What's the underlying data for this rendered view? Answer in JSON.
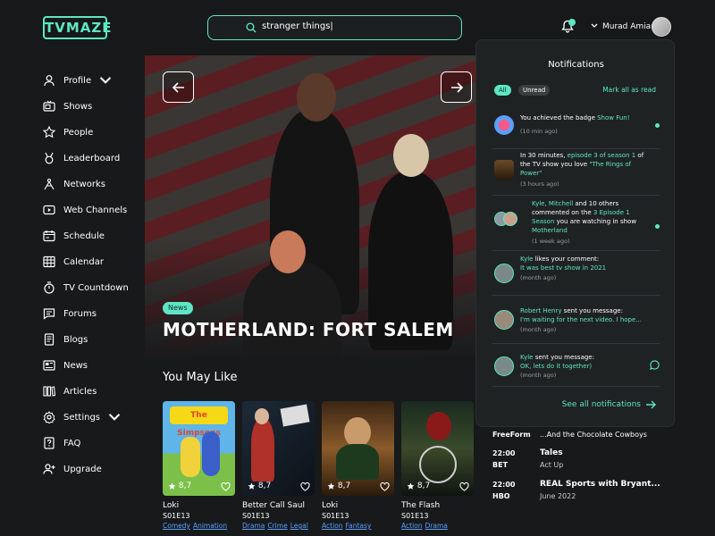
{
  "header": {
    "logo": "TVMAZE",
    "search_value": "stranger things|",
    "user_name": "Murad Amiar"
  },
  "sidebar": {
    "items": [
      {
        "label": "Profile",
        "icon": "user-icon"
      },
      {
        "label": "Shows",
        "icon": "tv-icon"
      },
      {
        "label": "People",
        "icon": "star-icon"
      },
      {
        "label": "Leaderboard",
        "icon": "medal-icon"
      },
      {
        "label": "Networks",
        "icon": "antenna-icon"
      },
      {
        "label": "Web Channels",
        "icon": "play-icon"
      },
      {
        "label": "Schedule",
        "icon": "schedule-icon"
      },
      {
        "label": "Calendar",
        "icon": "calendar-icon"
      },
      {
        "label": "TV Countdown",
        "icon": "timer-icon"
      },
      {
        "label": "Forums",
        "icon": "chat-icon"
      },
      {
        "label": "Blogs",
        "icon": "blog-icon"
      },
      {
        "label": "News",
        "icon": "news-icon"
      },
      {
        "label": "Articles",
        "icon": "articles-icon"
      },
      {
        "label": "Settings",
        "icon": "gear-icon"
      },
      {
        "label": "FAQ",
        "icon": "faq-icon"
      },
      {
        "label": "Upgrade",
        "icon": "user-plus-icon"
      }
    ]
  },
  "hero": {
    "tag": "News",
    "title": "MOTHERLAND: FORT SALEM"
  },
  "you_may_like": {
    "title": "You May Like",
    "cards": [
      {
        "title": "Loki",
        "episode": "S01E13",
        "rating": "8,7",
        "genres": [
          "Comedy",
          "Animation"
        ],
        "poster_text": "The Simpsons"
      },
      {
        "title": "Better Call Saul",
        "episode": "S01E13",
        "rating": "8,7",
        "genres": [
          "Drama",
          "Crime",
          "Legal"
        ],
        "poster_text": ""
      },
      {
        "title": "Loki",
        "episode": "S01E13",
        "rating": "8,7",
        "genres": [
          "Action",
          "Fantasy"
        ],
        "poster_text": ""
      },
      {
        "title": "The Flash",
        "episode": "S01E13",
        "rating": "8,7",
        "genres": [
          "Action",
          "Drama"
        ],
        "poster_text": ""
      }
    ]
  },
  "schedule": {
    "rows": [
      {
        "time": "FreeForm",
        "show": "...And the Chocolate Cowboys",
        "sub": ""
      },
      {
        "time": "22:00",
        "network": "BET",
        "show": "Tales",
        "sub": "Act Up"
      },
      {
        "time": "22:00",
        "network": "HBO",
        "show": "REAL Sports with Bryant...",
        "sub": "June 2022"
      }
    ]
  },
  "notifications": {
    "title": "Notifications",
    "filter_all": "All",
    "filter_unread": "Unread",
    "mark_all": "Mark all as read",
    "see_all": "See all notifications",
    "items": [
      {
        "pre": "You achieved the badge ",
        "hl": "Show Fun!",
        "post": "",
        "time": "(10 min ago)",
        "unread": true
      },
      {
        "pre": "In 30 minutes, ",
        "hl": "episode 3 of season 1",
        "post": " of the TV show you love ",
        "hl2": "\"The Rings of Power\"",
        "time": "(3 hours ago)",
        "unread": false
      },
      {
        "hl": "Kyle, Mitchell",
        "pre": " and 10 others commented on the ",
        "hl2": "3 Episode 1 Season",
        "post": " you are watching in show ",
        "hl3": "Motherland",
        "time": "(1 week ago)",
        "unread": true
      },
      {
        "hl": "Kyle",
        "pre": " likes your comment: ",
        "hl2": "It was best tv show in 2021",
        "time": "(month ago)",
        "unread": false
      },
      {
        "hl": "Robert Henry",
        "pre": " sent you message: ",
        "hl2": "I'm waiting for the next video. I hope...",
        "time": "(month ago)",
        "unread": false
      },
      {
        "hl": "Kyle",
        "pre": " sent you message: ",
        "hl2": "OK, lets do it together)",
        "time": "(month ago)",
        "unread": false
      }
    ]
  },
  "colors": {
    "accent": "#5ee6c4",
    "background": "#17191b",
    "panel": "#1f2223",
    "link": "#5aa0ff"
  }
}
